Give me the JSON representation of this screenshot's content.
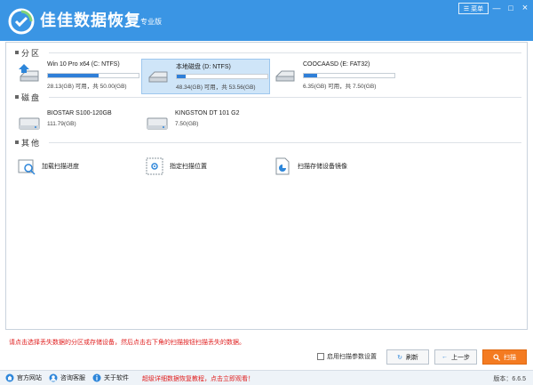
{
  "app": {
    "title": "佳佳数据恢复",
    "edition": "专业版",
    "menu_label": "菜单",
    "minimize": "—",
    "maximize": "□",
    "close": "×"
  },
  "sections": {
    "partitions": "分区",
    "disks": "磁盘",
    "others": "其他"
  },
  "partitions": [
    {
      "name": "Win 10 Pro x64 (C: NTFS)",
      "size": "28.13(GB) 可用，共 50.00(GB)",
      "fill": 0.56
    },
    {
      "name": "本地磁盘 (D: NTFS)",
      "size": "48.34(GB) 可用，共 53.56(GB)",
      "fill": 0.1
    },
    {
      "name": "COOCAASD (E: FAT32)",
      "size": "6.35(GB) 可用，共 7.50(GB)",
      "fill": 0.15
    }
  ],
  "disks": [
    {
      "name": "BIOSTAR S100-120GB",
      "size": "111.79(GB)"
    },
    {
      "name": "KINGSTON DT  101  G2",
      "size": "7.50(GB)"
    }
  ],
  "others": [
    {
      "label": "加载扫描进度"
    },
    {
      "label": "指定扫描位置"
    },
    {
      "label": "扫描存储设备镜像"
    }
  ],
  "hint": "请点击选择丢失数据的分区或存储设备，然后点击右下角的扫描按钮扫描丢失的数据。",
  "options": {
    "scan_params_label": "启用扫描参数设置"
  },
  "buttons": {
    "refresh": "刷新",
    "prev": "上一步",
    "scan": "扫描"
  },
  "footer": {
    "website": "官方网站",
    "support": "咨询客服",
    "about": "关于软件",
    "promo": "超级详细数据恢复教程，点击立即观看！",
    "version": "版本：6.6.5"
  },
  "colors": {
    "titlebar": "#3a95e4",
    "accent_orange": "#f47b21",
    "hint_red": "#e02020",
    "bar_fill": "#2f7fd8"
  }
}
